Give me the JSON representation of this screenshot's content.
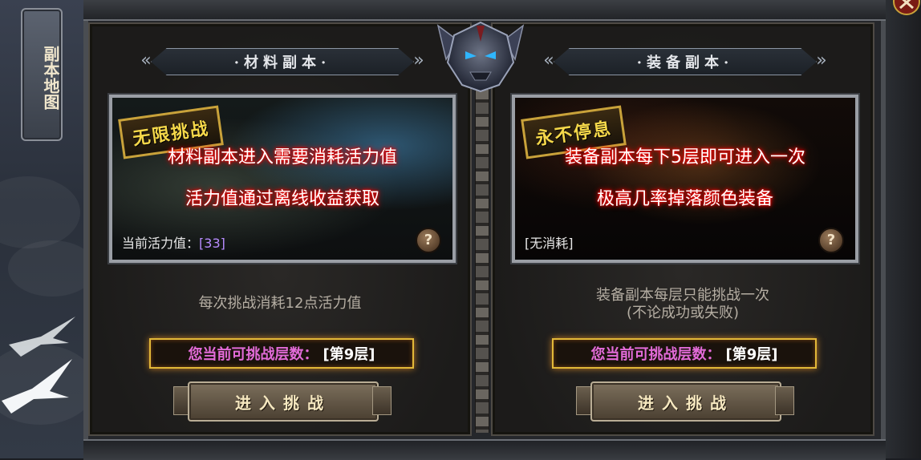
{
  "side_tab": {
    "label": "副本地图"
  },
  "colors": {
    "stage_label": "#e26bd8",
    "highlight_red": "#ff0000",
    "gold_border": "#e2b838",
    "counter_value": "#b88cff"
  },
  "panels": [
    {
      "title": "·材料副本·",
      "banner": "无限挑战",
      "lines": [
        "材料副本进入需要消耗活力值",
        "活力值通过离线收益获取"
      ],
      "footer_label": "当前活力值：",
      "footer_value": "[33]",
      "info_lines": [
        "每次挑战消耗12点活力值"
      ],
      "stage_label": "您当前可挑战层数：",
      "stage_value": "[第9层]",
      "button": "进入挑战"
    },
    {
      "title": "·装备副本·",
      "banner": "永不停息",
      "lines": [
        "装备副本每下5层即可进入一次",
        "极高几率掉落颜色装备"
      ],
      "footer_label": "[无消耗]",
      "footer_value": "",
      "info_lines": [
        "装备副本每层只能挑战一次",
        "(不论成功或失败)"
      ],
      "stage_label": "您当前可挑战层数：",
      "stage_value": "[第9层]",
      "button": "进入挑战"
    }
  ]
}
